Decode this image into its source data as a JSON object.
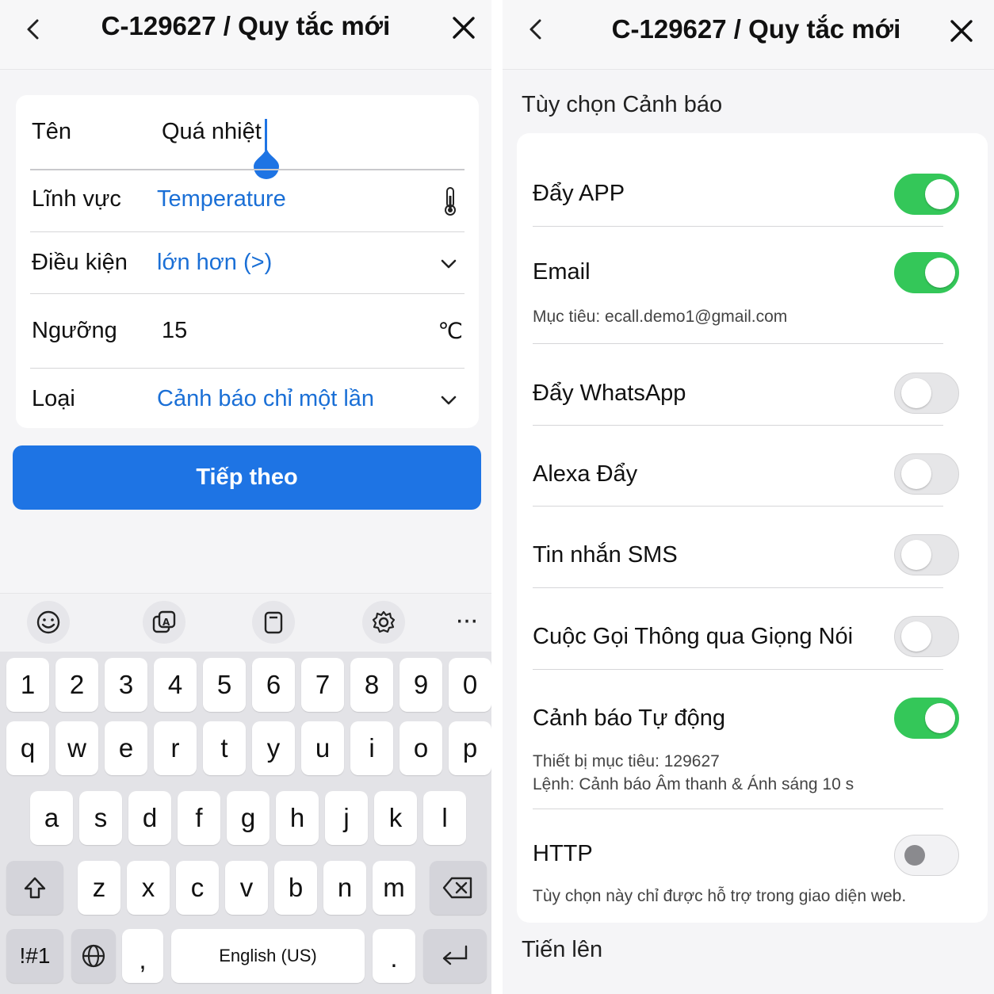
{
  "left": {
    "header": {
      "title": "C-129627 / Quy tắc mới"
    },
    "form": {
      "name_label": "Tên",
      "name_value": "Quá nhiệt",
      "field_label": "Lĩnh vực",
      "field_value": "Temperature",
      "condition_label": "Điều kiện",
      "condition_value": "lớn hơn (>)",
      "threshold_label": "Ngưỡng",
      "threshold_value": "15",
      "threshold_unit": "℃",
      "type_label": "Loại",
      "type_value": "Cảnh báo chỉ một lần"
    },
    "next_button": "Tiếp theo",
    "keyboard": {
      "toolbar": {
        "more": "···"
      },
      "number_row": [
        "1",
        "2",
        "3",
        "4",
        "5",
        "6",
        "7",
        "8",
        "9",
        "0"
      ],
      "row1": [
        "q",
        "w",
        "e",
        "r",
        "t",
        "y",
        "u",
        "i",
        "o",
        "p"
      ],
      "row2": [
        "a",
        "s",
        "d",
        "f",
        "g",
        "h",
        "j",
        "k",
        "l"
      ],
      "row3": [
        "z",
        "x",
        "c",
        "v",
        "b",
        "n",
        "m"
      ],
      "symbols_key": "!#1",
      "comma_key": ",",
      "space_label": "English (US)",
      "period_key": "."
    }
  },
  "right": {
    "header": {
      "title": "C-129627 / Quy tắc mới"
    },
    "section_title": "Tùy chọn Cảnh báo",
    "items": [
      {
        "label": "Đẩy APP",
        "on": true
      },
      {
        "label": "Email",
        "on": true,
        "sub": "Mục tiêu: ecall.demo1@gmail.com"
      },
      {
        "label": "Đẩy WhatsApp",
        "on": false
      },
      {
        "label": "Alexa Đẩy",
        "on": false
      },
      {
        "label": "Tin nhắn SMS",
        "on": false
      },
      {
        "label": "Cuộc Gọi Thông qua Giọng Nói",
        "on": false
      },
      {
        "label": "Cảnh báo Tự động",
        "on": true,
        "sub": "Thiết bị mục tiêu: 129627",
        "sub2": "Lệnh: Cảnh báo Âm thanh & Ánh sáng 10 s"
      },
      {
        "label": "HTTP",
        "on": false,
        "disabled": true,
        "sub": "Tùy chọn này chỉ được hỗ trợ trong giao diện web."
      }
    ],
    "footer_title": "Tiến lên"
  },
  "colors": {
    "accent": "#1e74e4",
    "link": "#1a6fd6",
    "toggle_on": "#34c759"
  }
}
